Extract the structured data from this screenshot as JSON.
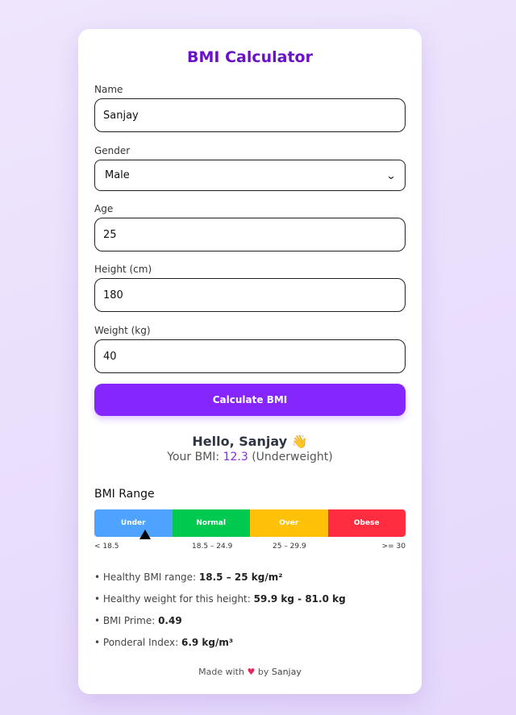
{
  "title": "BMI Calculator",
  "form": {
    "name_label": "Name",
    "name_value": "Sanjay",
    "gender_label": "Gender",
    "gender_value": "Male",
    "age_label": "Age",
    "age_value": "25",
    "height_label": "Height (cm)",
    "height_value": "180",
    "weight_label": "Weight (kg)",
    "weight_value": "40",
    "calculate_label": "Calculate BMI"
  },
  "result": {
    "greeting": "Hello, Sanjay 👋",
    "bmi_prefix": "Your BMI:",
    "bmi_value": "12.3",
    "bmi_category": "(Underweight)"
  },
  "range": {
    "title": "BMI Range",
    "segments": [
      {
        "label": "Under",
        "color": "#4da3ff"
      },
      {
        "label": "Normal",
        "color": "#00c94f"
      },
      {
        "label": "Over",
        "color": "#ffc107"
      },
      {
        "label": "Obese",
        "color": "#ff2d3f"
      }
    ],
    "ticks": [
      "< 18.5",
      "18.5 – 24.9",
      "25 – 29.9",
      ">= 30"
    ],
    "pointer_segment": "Under"
  },
  "info": {
    "healthy_range_label": "• Healthy BMI range:",
    "healthy_range_value": "18.5 – 25 kg/m²",
    "healthy_weight_label": "• Healthy weight for this height:",
    "healthy_weight_value": "59.9 kg - 81.0 kg",
    "prime_label": "• BMI Prime:",
    "prime_value": "0.49",
    "ponderal_label": "• Ponderal Index:",
    "ponderal_value": "6.9 kg/m³"
  },
  "footer": {
    "made_with": "Made with",
    "heart": "♥",
    "by": "by",
    "author": "Sanjay"
  }
}
